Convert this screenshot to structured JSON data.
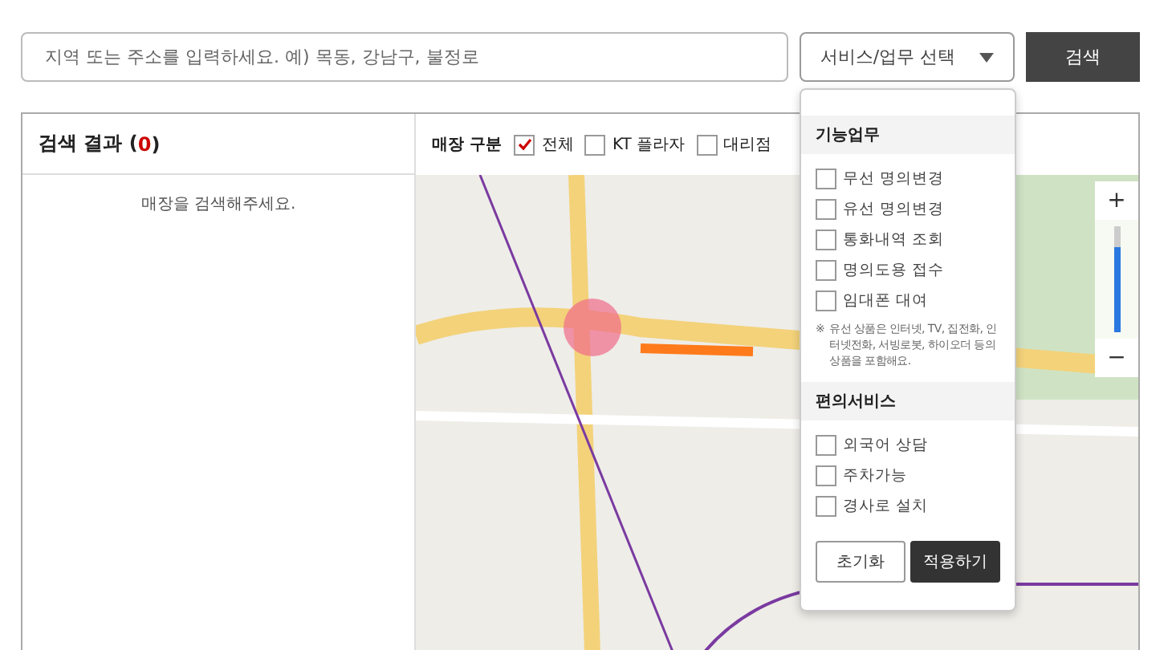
{
  "search": {
    "placeholder": "지역 또는 주소를 입력하세요. 예) 목동, 강남구, 불정로"
  },
  "service_select": {
    "label": "서비스/업무 선택",
    "expanded": true
  },
  "search_button": "검색",
  "results": {
    "title": "검색 결과 (",
    "count": "0",
    "title_end": ")",
    "empty_message": "매장을 검색해주세요."
  },
  "store_type": {
    "label": "매장 구분",
    "options": [
      {
        "label": "전체",
        "checked": true
      },
      {
        "label": "KT 플라자",
        "checked": false
      },
      {
        "label": "대리점",
        "checked": false
      }
    ]
  },
  "dropdown": {
    "sections": [
      {
        "title": "기능업무",
        "items": [
          {
            "label": "무선 명의변경",
            "checked": false
          },
          {
            "label": "유선 명의변경",
            "checked": false
          },
          {
            "label": "통화내역 조회",
            "checked": false
          },
          {
            "label": "명의도용 접수",
            "checked": false
          },
          {
            "label": "임대폰 대여",
            "checked": false
          }
        ],
        "note_mark": "※",
        "note": "유선 상품은 인터넷, TV, 집전화, 인터넷전화, 서빙로봇, 하이오더 등의 상품을 포함해요."
      },
      {
        "title": "편의서비스",
        "items": [
          {
            "label": "외국어 상담",
            "checked": false
          },
          {
            "label": "주차가능",
            "checked": false
          },
          {
            "label": "경사로 설치",
            "checked": false
          }
        ]
      }
    ],
    "buttons": [
      {
        "label": "초기화",
        "kind": "secondary"
      },
      {
        "label": "적용하기",
        "kind": "primary"
      }
    ]
  },
  "zoom": {
    "in": "+",
    "out": "−",
    "level": 0.8
  }
}
